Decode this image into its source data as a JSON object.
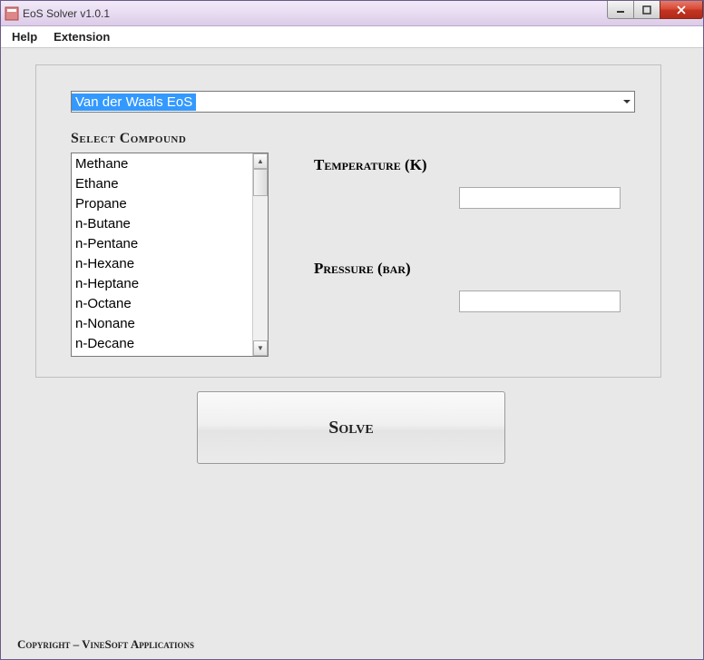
{
  "window": {
    "title": "EoS Solver v1.0.1"
  },
  "menu": {
    "help": "Help",
    "extension": "Extension"
  },
  "eos_dropdown": {
    "selected": "Van der Waals EoS"
  },
  "labels": {
    "select_compound": "Select Compound",
    "temperature": "Temperature (K)",
    "pressure": "Pressure (bar)",
    "solve": "Solve"
  },
  "compounds": [
    "Methane",
    "Ethane",
    "Propane",
    "n-Butane",
    "n-Pentane",
    "n-Hexane",
    "n-Heptane",
    "n-Octane",
    "n-Nonane",
    "n-Decane"
  ],
  "inputs": {
    "temperature": "",
    "pressure": ""
  },
  "footer": {
    "copyright": "Copyright – VineSoft Applications"
  }
}
